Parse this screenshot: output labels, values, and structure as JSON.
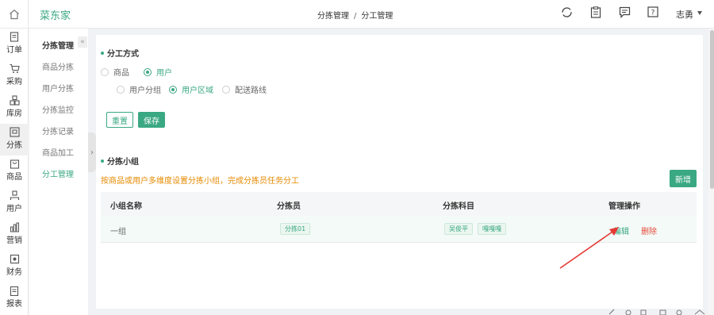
{
  "app": {
    "brand": "菜东家"
  },
  "breadcrumb": {
    "parent": "分拣管理",
    "separator": "/",
    "current": "分工管理"
  },
  "header": {
    "user_name": "志勇",
    "icons": [
      "refresh-icon",
      "clipboard-icon",
      "message-icon",
      "help-icon"
    ]
  },
  "nav": {
    "items": [
      {
        "label": "订单",
        "icon": "document-icon"
      },
      {
        "label": "采购",
        "icon": "cart-icon"
      },
      {
        "label": "库房",
        "icon": "warehouse-icon"
      },
      {
        "label": "分拣",
        "icon": "sorting-icon"
      },
      {
        "label": "商品",
        "icon": "bag-icon"
      },
      {
        "label": "用户",
        "icon": "user-icon"
      },
      {
        "label": "营销",
        "icon": "chart-icon"
      },
      {
        "label": "财务",
        "icon": "finance-icon"
      },
      {
        "label": "报表",
        "icon": "report-icon"
      }
    ],
    "active_index": 3
  },
  "subnav": {
    "title": "分拣管理",
    "items": [
      "商品分拣",
      "用户分拣",
      "分拣监控",
      "分拣记录",
      "商品加工",
      "分工管理"
    ],
    "active_index": 5
  },
  "division": {
    "title": "分工方式",
    "mode_options": [
      "商品",
      "用户"
    ],
    "mode_selected": "用户",
    "sub_options": [
      "用户分组",
      "用户区域",
      "配送路线"
    ],
    "sub_selected": "用户区域",
    "reset_label": "重置",
    "save_label": "保存"
  },
  "groups": {
    "title": "分拣小组",
    "hint": "按商品或用户多维度设置分拣小组，完成分拣员任务分工",
    "add_label": "新增",
    "columns": [
      "小组名称",
      "分拣员",
      "分拣科目",
      "管理操作"
    ],
    "rows": [
      {
        "name": "一组",
        "sorters": [
          "分拣01"
        ],
        "subjects": [
          "吴俊平",
          "嘎嘎嘎"
        ],
        "edit_label": "编辑",
        "delete_label": "删除"
      }
    ]
  },
  "colors": {
    "accent": "#3aa882",
    "hint": "#e68a00",
    "danger": "#e74c3c",
    "arrow": "#e53935"
  }
}
